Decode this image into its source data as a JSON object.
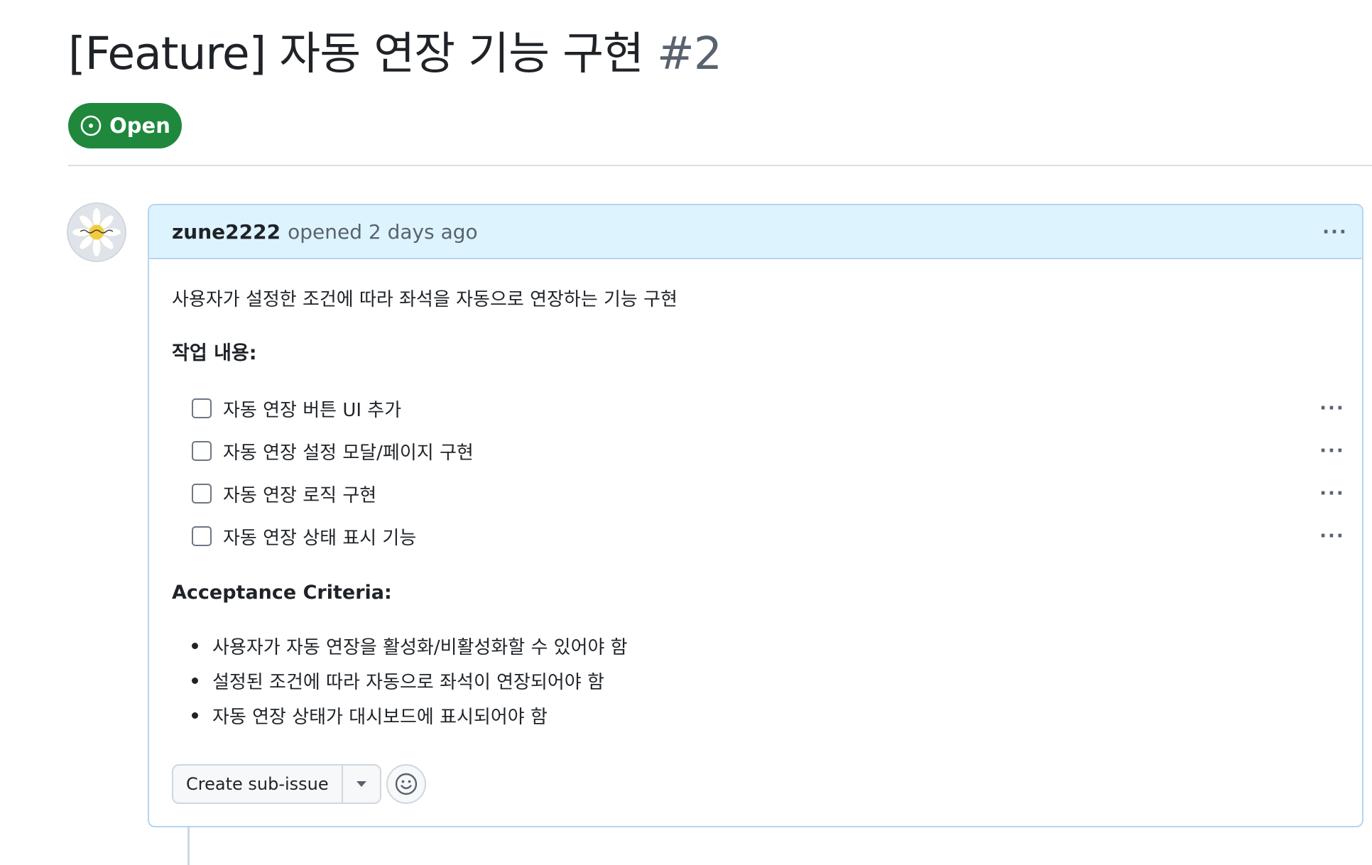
{
  "issue": {
    "title": "[Feature] 자동 연장 기능 구현",
    "number": "#2",
    "state": "Open",
    "state_color": "#1f883d"
  },
  "comment": {
    "author": "zune2222",
    "meta": "opened 2 days ago",
    "more_label": "···",
    "description": "사용자가 설정한 조건에 따라 좌석을 자동으로 연장하는 기능 구현",
    "tasks_heading": "작업 내용:",
    "tasks": [
      {
        "label": "자동 연장 버튼 UI 추가",
        "checked": false
      },
      {
        "label": "자동 연장 설정 모달/페이지 구현",
        "checked": false
      },
      {
        "label": "자동 연장 로직 구현",
        "checked": false
      },
      {
        "label": "자동 연장 상태 표시 기능",
        "checked": false
      }
    ],
    "criteria_heading": "Acceptance Criteria:",
    "criteria": [
      "사용자가 자동 연장을 활성화/비활성화할 수 있어야 함",
      "설정된 조건에 따라 자동으로 좌석이 연장되어야 함",
      "자동 연장 상태가 대시보드에 표시되어야 함"
    ]
  },
  "actions": {
    "create_sub_issue": "Create sub-issue",
    "dropdown_icon": "triangle-down-icon",
    "reaction_icon": "smiley-icon"
  },
  "colors": {
    "header_bg": "#ddf4ff",
    "border": "#b6d4f3",
    "muted_text": "#59636e"
  }
}
